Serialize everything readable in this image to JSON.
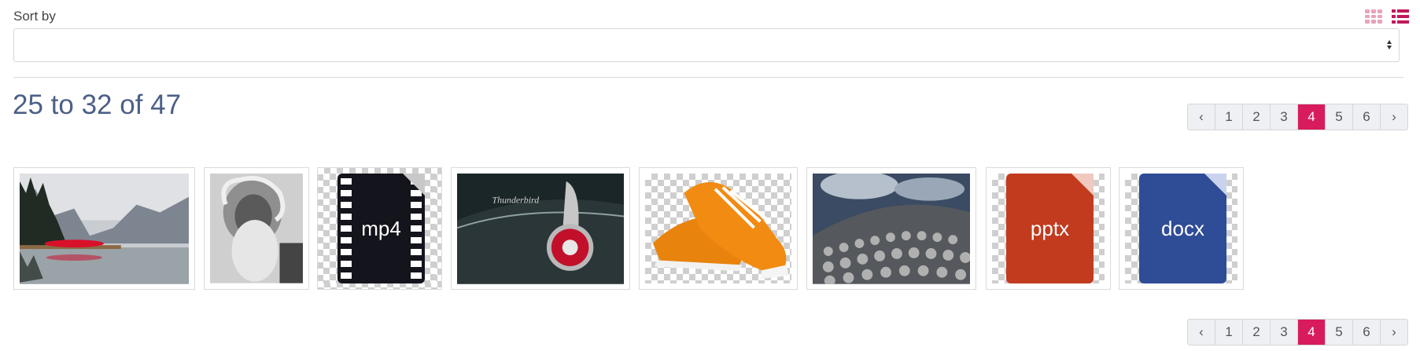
{
  "sort": {
    "label": "Sort by",
    "value": ""
  },
  "results": {
    "summary": "25 to 32 of 47"
  },
  "pagination": {
    "prev": "‹",
    "next": "›",
    "pages": [
      "1",
      "2",
      "3",
      "4",
      "5",
      "6"
    ],
    "current": "4"
  },
  "view": {
    "grid_icon": "grid-icon",
    "list_icon": "list-icon",
    "accent": "#d81b5d"
  },
  "thumbnails": [
    {
      "kind": "image",
      "subject": "lake-with-red-canoe"
    },
    {
      "kind": "image",
      "subject": "old-man-portrait"
    },
    {
      "kind": "file",
      "label": "mp4"
    },
    {
      "kind": "image",
      "subject": "classic-car-taillight"
    },
    {
      "kind": "image",
      "subject": "orange-sneakers"
    },
    {
      "kind": "image",
      "subject": "building-facade"
    },
    {
      "kind": "file",
      "label": "pptx"
    },
    {
      "kind": "file",
      "label": "docx"
    }
  ]
}
